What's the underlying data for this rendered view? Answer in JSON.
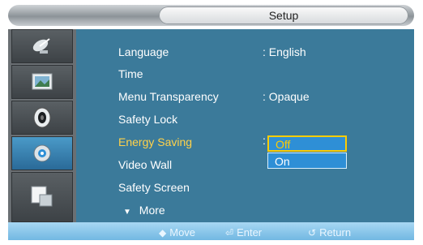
{
  "header": {
    "title": "Setup"
  },
  "sidebar": {
    "items": [
      {
        "icon": "satellite-dish-icon"
      },
      {
        "icon": "picture-icon"
      },
      {
        "icon": "speaker-icon"
      },
      {
        "icon": "setup-gear-icon"
      },
      {
        "icon": "multi-screen-icon"
      }
    ]
  },
  "menu": {
    "items": [
      {
        "label": "Language",
        "value": ": English"
      },
      {
        "label": "Time",
        "value": ""
      },
      {
        "label": "Menu Transparency",
        "value": ": Opaque"
      },
      {
        "label": "Safety Lock",
        "value": ""
      },
      {
        "label": "Energy Saving",
        "value": ":"
      },
      {
        "label": "Video Wall",
        "value": ""
      },
      {
        "label": "Safety Screen",
        "value": ""
      }
    ],
    "more_label": "More"
  },
  "dropdown": {
    "options": [
      "Off",
      "On"
    ],
    "selected": "Off"
  },
  "footer": {
    "move_label": "Move",
    "enter_label": "Enter",
    "return_label": "Return"
  },
  "colors": {
    "panel": "#3b7a9a",
    "highlight_text": "#ffd24a",
    "dropdown_bg": "#2e8fd6",
    "dropdown_selected_border": "#ffcc00"
  }
}
